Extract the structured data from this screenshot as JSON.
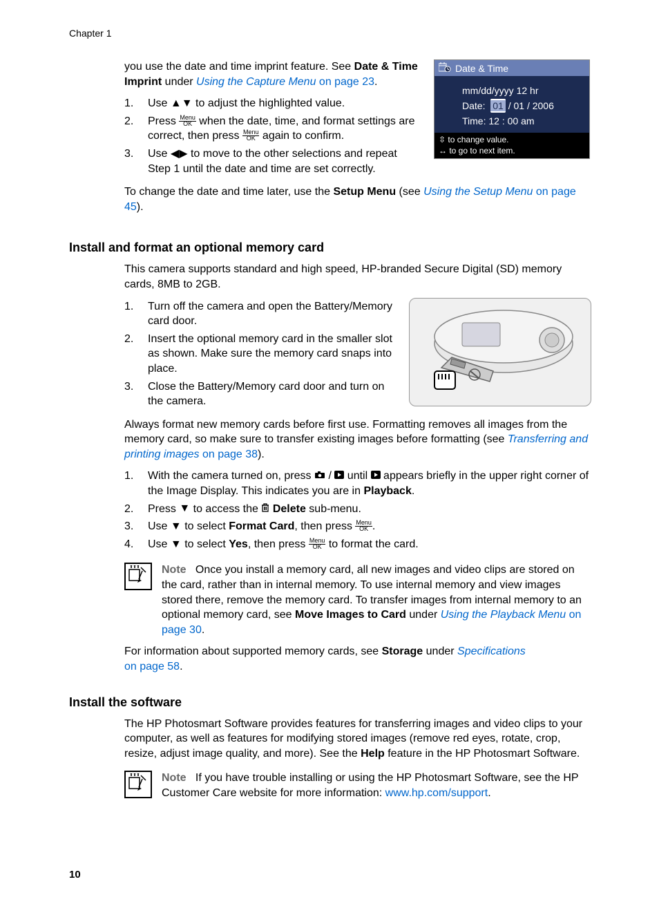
{
  "chapter_label": "Chapter 1",
  "intro_block": {
    "text_a": "you use the date and time imprint feature. See ",
    "bold_a": "Date & Time Imprint",
    "text_b": " under ",
    "link_a": "Using the Capture Menu",
    "link_a_pg": " on page 23",
    "text_c": "."
  },
  "dt_list": {
    "i1_a": "Use ",
    "i1_b": " to adjust the highlighted value.",
    "i2_a": "Press ",
    "i2_b": " when the date, time, and format settings are correct, then press ",
    "i2_c": " again to confirm.",
    "i3_a": "Use ",
    "i3_b": " to move to the other selections and repeat Step 1 until the date and time are set correctly."
  },
  "dt_after": {
    "a": "To change the date and time later, use the ",
    "b": "Setup Menu",
    "c": " (see ",
    "link": "Using the Setup Menu",
    "pg": " on page 45",
    "d": ")."
  },
  "dt_screen": {
    "title": "Date & Time",
    "format_row": "mm/dd/yyyy  12 hr",
    "date_label": "Date:",
    "date_hl": "01",
    "date_rest": " / 01 / 2006",
    "time_label": "Time:",
    "time_value": " 12 : 00  am",
    "footer1_a": " to change value.",
    "footer2_a": " to go to next item."
  },
  "sec2_heading": "Install and format an optional memory card",
  "sec2_intro": "This camera supports standard and high speed, HP-branded Secure Digital (SD) memory cards, 8MB to 2GB.",
  "sec2_list": {
    "i1": "Turn off the camera and open the Battery/Memory card door.",
    "i2": "Insert the optional memory card in the smaller slot as shown. Make sure the memory card snaps into place.",
    "i3": "Close the Battery/Memory card door and turn on the camera."
  },
  "sec2_para2_a": "Always format new memory cards before first use. Formatting removes all images from the memory card, so make sure to transfer existing images before formatting (see ",
  "sec2_para2_link": "Transferring and printing images",
  "sec2_para2_pg": " on page 38",
  "sec2_para2_b": ").",
  "sec2_list2": {
    "i1_a": "With the camera turned on, press ",
    "i1_b": " until ",
    "i1_c": " appears briefly in the upper right corner of the Image Display. This indicates you are in ",
    "i1_d": "Playback",
    "i1_e": ".",
    "i2_a": "Press ",
    "i2_b": " to access the ",
    "i2_c": "Delete",
    "i2_d": " sub-menu.",
    "i3_a": "Use ",
    "i3_b": " to select ",
    "i3_c": "Format Card",
    "i3_d": ", then press ",
    "i3_e": ".",
    "i4_a": "Use ",
    "i4_b": " to select ",
    "i4_c": "Yes",
    "i4_d": ", then press ",
    "i4_e": " to format the card."
  },
  "note1": {
    "label": "Note",
    "text_a": "Once you install a memory card, all new images and video clips are stored on the card, rather than in internal memory. To use internal memory and view images stored there, remove the memory card. To transfer images from internal memory to an optional memory card, see ",
    "bold": "Move Images to Card",
    "text_b": " under ",
    "link": "Using the Playback Menu",
    "pg": " on page 30",
    "text_c": "."
  },
  "sec2_para3_a": "For information about supported memory cards, see ",
  "sec2_para3_b": "Storage",
  "sec2_para3_c": " under ",
  "sec2_para3_link": "Specifications",
  "sec2_para3_pg": "on page 58",
  "sec2_para3_d": ".",
  "sec3_heading": "Install the software",
  "sec3_para_a": "The HP Photosmart Software provides features for transferring images and video clips to your computer, as well as features for modifying stored images (remove red eyes, rotate, crop, resize, adjust image quality, and more). See the ",
  "sec3_para_b": "Help",
  "sec3_para_c": " feature in the HP Photosmart Software.",
  "note2": {
    "label": "Note",
    "text_a": "If you have trouble installing or using the HP Photosmart Software, see the HP Customer Care website for more information: ",
    "link": "www.hp.com/support",
    "text_b": "."
  },
  "page_number": "10",
  "icons": {
    "menu": "Menu",
    "ok": "OK"
  }
}
